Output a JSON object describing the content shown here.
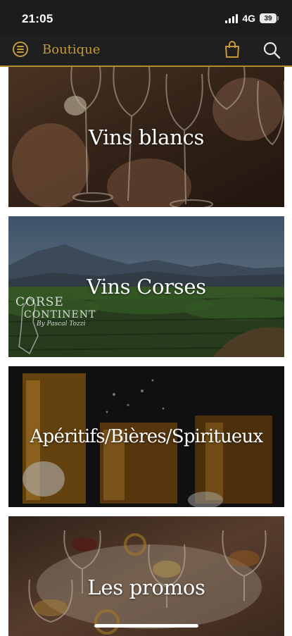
{
  "status_bar": {
    "time": "21:05",
    "network": "4G",
    "battery": "39"
  },
  "app_bar": {
    "title": "Boutique",
    "menu_icon": "menu-circle-icon",
    "cart_icon": "shopping-bag-icon",
    "search_icon": "search-icon"
  },
  "categories": [
    {
      "label": "Vins blancs"
    },
    {
      "label": "Vins Corses"
    },
    {
      "label": "Apéritifs/Bières/Spiritueux"
    },
    {
      "label": "Les promos"
    }
  ],
  "colors": {
    "accent": "#c69a3c",
    "bar_background": "#1f1f1f"
  }
}
